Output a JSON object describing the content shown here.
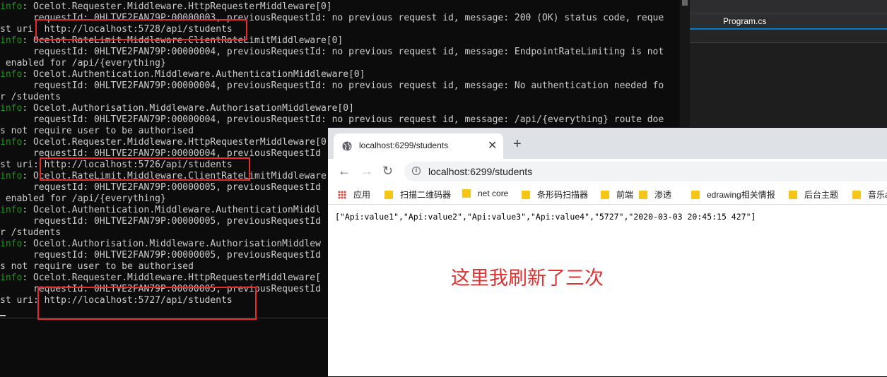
{
  "console": {
    "lines": [
      {
        "level": "info",
        "text": ": Ocelot.Requester.Middleware.HttpRequesterMiddleware[0]"
      },
      {
        "level": "",
        "text": "      requestId: 0HLTVE2FAN79P:00000003, previousRequestId: no previous request id, message: 200 (OK) status code, reque"
      },
      {
        "level": "",
        "text": "st uri: http://localhost:5728/api/students"
      },
      {
        "level": "info",
        "text": ": Ocelot.RateLimit.Middleware.ClientRateLimitMiddleware[0]"
      },
      {
        "level": "",
        "text": "      requestId: 0HLTVE2FAN79P:00000004, previousRequestId: no previous request id, message: EndpointRateLimiting is not"
      },
      {
        "level": "",
        "text": " enabled for /api/{everything}"
      },
      {
        "level": "info",
        "text": ": Ocelot.Authentication.Middleware.AuthenticationMiddleware[0]"
      },
      {
        "level": "",
        "text": "      requestId: 0HLTVE2FAN79P:00000004, previousRequestId: no previous request id, message: No authentication needed fo"
      },
      {
        "level": "",
        "text": "r /students"
      },
      {
        "level": "info",
        "text": ": Ocelot.Authorisation.Middleware.AuthorisationMiddleware[0]"
      },
      {
        "level": "",
        "text": "      requestId: 0HLTVE2FAN79P:00000004, previousRequestId: no previous request id, message: /api/{everything} route doe"
      },
      {
        "level": "",
        "text": "s not require user to be authorised"
      },
      {
        "level": "info",
        "text": ": Ocelot.Requester.Middleware.HttpRequesterMiddleware[0]"
      },
      {
        "level": "",
        "text": "      requestId: 0HLTVE2FAN79P:00000004, previousRequestId"
      },
      {
        "level": "",
        "text": "st uri: http://localhost:5726/api/students"
      },
      {
        "level": "info",
        "text": ": Ocelot.RateLimit.Middleware.ClientRateLimitMiddleware"
      },
      {
        "level": "",
        "text": "      requestId: 0HLTVE2FAN79P:00000005, previousRequestId"
      },
      {
        "level": "",
        "text": " enabled for /api/{everything}"
      },
      {
        "level": "info",
        "text": ": Ocelot.Authentication.Middleware.AuthenticationMiddl"
      },
      {
        "level": "",
        "text": "      requestId: 0HLTVE2FAN79P:00000005, previousRequestId"
      },
      {
        "level": "",
        "text": "r /students"
      },
      {
        "level": "info",
        "text": ": Ocelot.Authorisation.Middleware.AuthorisationMiddlew"
      },
      {
        "level": "",
        "text": "      requestId: 0HLTVE2FAN79P:00000005, previousRequestId"
      },
      {
        "level": "",
        "text": "s not require user to be authorised"
      },
      {
        "level": "info",
        "text": ": Ocelot.Requester.Middleware.HttpRequesterMiddleware["
      },
      {
        "level": "",
        "text": "      requestId: 0HLTVE2FAN79P:00000005, previousRequestId"
      },
      {
        "level": "",
        "text": "st uri: http://localhost:5727/api/students"
      }
    ]
  },
  "ide": {
    "tab_label": "Program.cs"
  },
  "browser": {
    "tab_title": "localhost:6299/students",
    "tab_close": "✕",
    "new_tab": "+",
    "url": "localhost:6299/students",
    "bookmarks": [
      {
        "label": "应用",
        "icon": "apps-icon"
      },
      {
        "label": "扫描二维码器",
        "icon": "folder-icon"
      },
      {
        "label": "net core",
        "icon": "folder-icon"
      },
      {
        "label": "条形码扫描器",
        "icon": "folder-icon"
      },
      {
        "label": "前端",
        "icon": "folder-icon"
      },
      {
        "label": "渗透",
        "icon": "folder-icon"
      },
      {
        "label": "edrawing相关情报",
        "icon": "folder-icon"
      },
      {
        "label": "后台主题",
        "icon": "folder-icon"
      },
      {
        "label": "音乐a",
        "icon": "folder-icon"
      }
    ],
    "body_text": "[\"Api:value1\",\"Api:value2\",\"Api:value3\",\"Api:value4\",\"5727\",\"2020-03-03 20:45:15 427\"]"
  },
  "annotation": "这里我刷新了三次",
  "colors": {
    "highlight": "#e52c2c",
    "info_level": "#13a10e",
    "annotation": "#e0302f",
    "folder": "#f5c518",
    "ide_accent": "#007acc"
  }
}
